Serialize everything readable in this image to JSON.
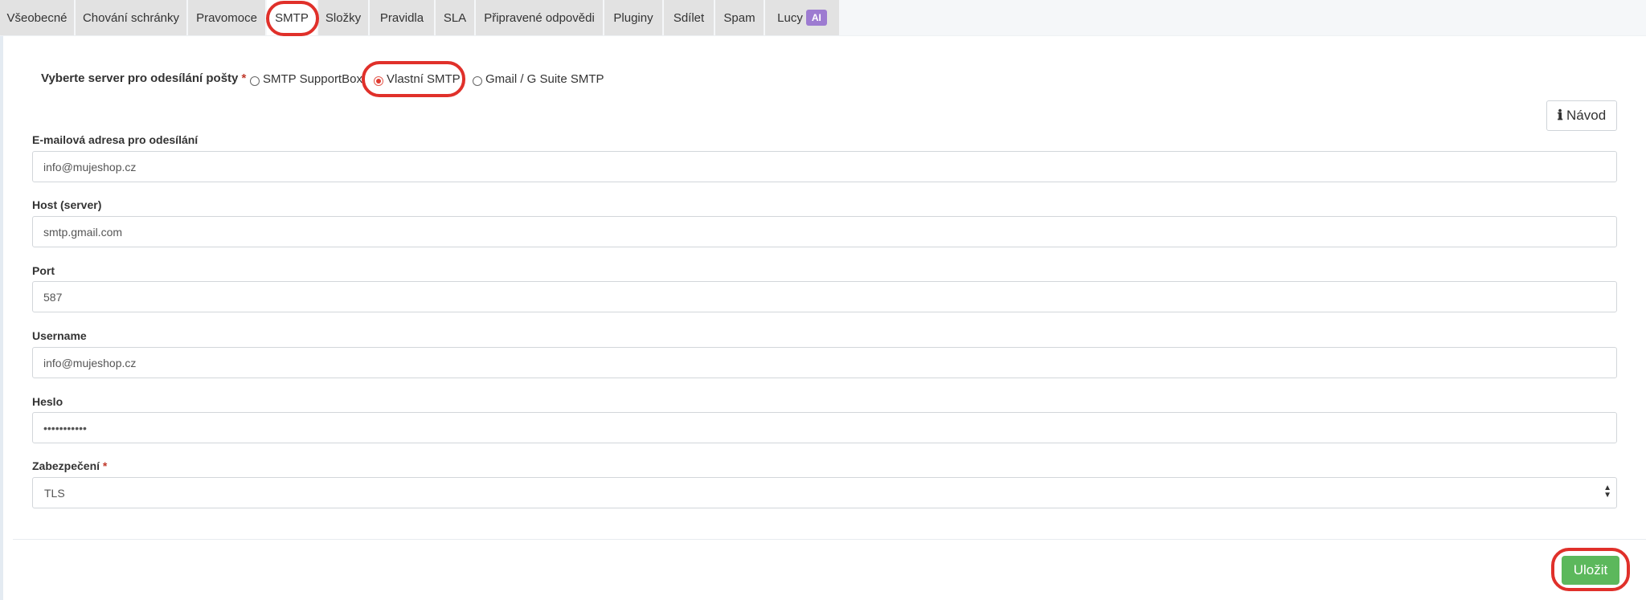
{
  "tabs": [
    {
      "label": "Všeobecné",
      "active": false
    },
    {
      "label": "Chování schránky",
      "active": false
    },
    {
      "label": "Pravomoce",
      "active": false
    },
    {
      "label": "SMTP",
      "active": true
    },
    {
      "label": "Složky",
      "active": false
    },
    {
      "label": "Pravidla",
      "active": false
    },
    {
      "label": "SLA",
      "active": false
    },
    {
      "label": "Připravené odpovědi",
      "active": false
    },
    {
      "label": "Pluginy",
      "active": false
    },
    {
      "label": "Sdílet",
      "active": false
    },
    {
      "label": "Spam",
      "active": false
    },
    {
      "label": "Lucy",
      "badge": "AI",
      "active": false
    }
  ],
  "server_select": {
    "label": "Vyberte server pro odesílání pošty",
    "required_mark": "*",
    "options": [
      "SMTP SupportBox",
      "Vlastní SMTP",
      "Gmail / G Suite SMTP"
    ],
    "selected": "Vlastní SMTP"
  },
  "guide_button": {
    "icon": "info-icon",
    "label": "Návod"
  },
  "fields": {
    "sender_email": {
      "label": "E-mailová adresa pro odesílání",
      "value": "info@mujeshop.cz"
    },
    "host": {
      "label": "Host (server)",
      "value": "smtp.gmail.com"
    },
    "port": {
      "label": "Port",
      "value": "587"
    },
    "username": {
      "label": "Username",
      "value": "info@mujeshop.cz"
    },
    "password": {
      "label": "Heslo",
      "value": "•••••••••••"
    },
    "security": {
      "label": "Zabezpečení",
      "required_mark": "*",
      "value": "TLS"
    }
  },
  "save_button": {
    "label": "Uložit"
  },
  "colors": {
    "highlight": "#e0302a",
    "save": "#5cb85c",
    "badge": "#9d7bd1",
    "radio_checked": "#e03c31"
  }
}
